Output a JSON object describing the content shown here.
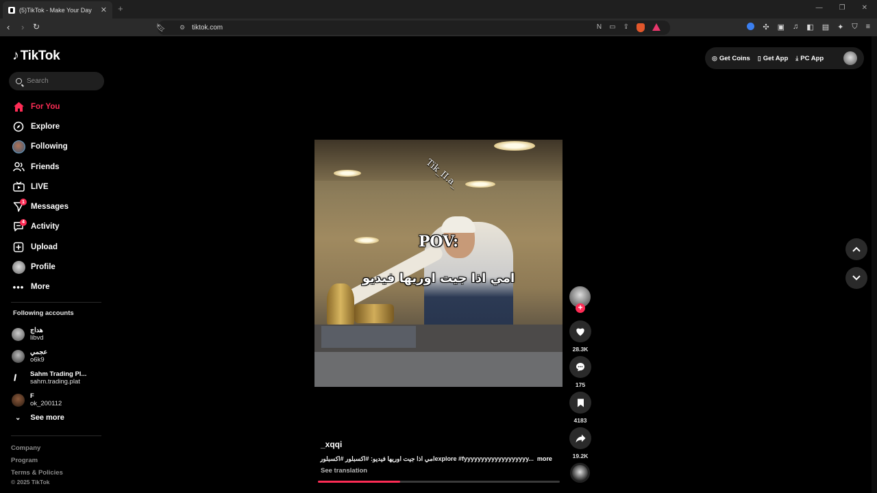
{
  "browser": {
    "tab_title": "(5)TikTok - Make Your Day",
    "tab_close": "✕",
    "new_tab": "+",
    "url": "tiktok.com"
  },
  "sidebar": {
    "logo": "TikTok",
    "search_placeholder": "Search",
    "nav": [
      {
        "label": "For You",
        "icon": "home-icon",
        "active": true
      },
      {
        "label": "Explore",
        "icon": "compass-icon"
      },
      {
        "label": "Following",
        "icon": "following-avatar"
      },
      {
        "label": "Friends",
        "icon": "friends-icon"
      },
      {
        "label": "LIVE",
        "icon": "live-tv-icon"
      },
      {
        "label": "Messages",
        "icon": "messages-icon",
        "badge": "1"
      },
      {
        "label": "Activity",
        "icon": "activity-icon",
        "badge": "4"
      },
      {
        "label": "Upload",
        "icon": "upload-icon"
      },
      {
        "label": "Profile",
        "icon": "profile-avatar"
      },
      {
        "label": "More",
        "icon": "more-icon"
      }
    ],
    "following_title": "Following accounts",
    "following": [
      {
        "display": "هداج",
        "handle": "libvd"
      },
      {
        "display": "عجمي",
        "handle": "o6k9"
      },
      {
        "display": "Sahm Trading Pl...",
        "handle": "sahm.trading.plat"
      },
      {
        "display": "F",
        "handle": "ok_200112"
      }
    ],
    "see_more": "See more",
    "footer": [
      "Company",
      "Program",
      "Terms & Policies"
    ],
    "copyright": "© 2025 TikTok"
  },
  "topbar": {
    "get_coins": "Get Coins",
    "get_app": "Get App",
    "pc_app": "PC App"
  },
  "video": {
    "watermark": "Tik_II.a_",
    "overlay_title": "POV:",
    "overlay_arabic": "امي اذا جيت اوريها فيديو",
    "author": "_xqqi",
    "caption": "امي اذا جيت اوريها فيديو: #اكسبلور #اكسبلورexplore #fyyyyyyyyyyyyyyyyyyy...",
    "more": "more",
    "see_translation": "See translation",
    "progress_percent": 34
  },
  "actions": {
    "follow": "+",
    "likes": "28.3K",
    "comments": "175",
    "saves": "4183",
    "shares": "19.2K"
  },
  "colors": {
    "accent": "#fe2c55",
    "background": "#000000",
    "panel": "#1c1c1c"
  }
}
